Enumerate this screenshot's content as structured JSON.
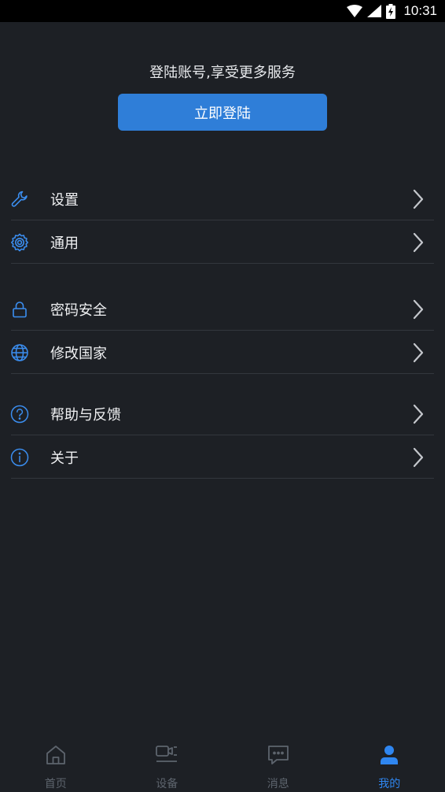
{
  "status_bar": {
    "time": "10:31"
  },
  "header": {
    "prompt": "登陆账号,享受更多服务",
    "login_button": "立即登陆"
  },
  "menu": {
    "items": [
      {
        "label": "设置",
        "icon": "wrench-icon"
      },
      {
        "label": "通用",
        "icon": "gear-icon"
      },
      {
        "label": "密码安全",
        "icon": "lock-icon"
      },
      {
        "label": "修改国家",
        "icon": "globe-icon"
      },
      {
        "label": "帮助与反馈",
        "icon": "help-icon"
      },
      {
        "label": "关于",
        "icon": "info-icon"
      }
    ]
  },
  "bottom_nav": {
    "tabs": [
      {
        "label": "首页",
        "icon": "home-icon",
        "active": false
      },
      {
        "label": "设备",
        "icon": "camera-device-icon",
        "active": false
      },
      {
        "label": "消息",
        "icon": "message-icon",
        "active": false
      },
      {
        "label": "我的",
        "icon": "person-icon",
        "active": true
      }
    ]
  },
  "colors": {
    "background": "#1d2025",
    "accent": "#2f7ed8",
    "icon": "#3b8ef0",
    "inactive_nav": "#5d646d",
    "active_nav": "#2f86f0"
  }
}
